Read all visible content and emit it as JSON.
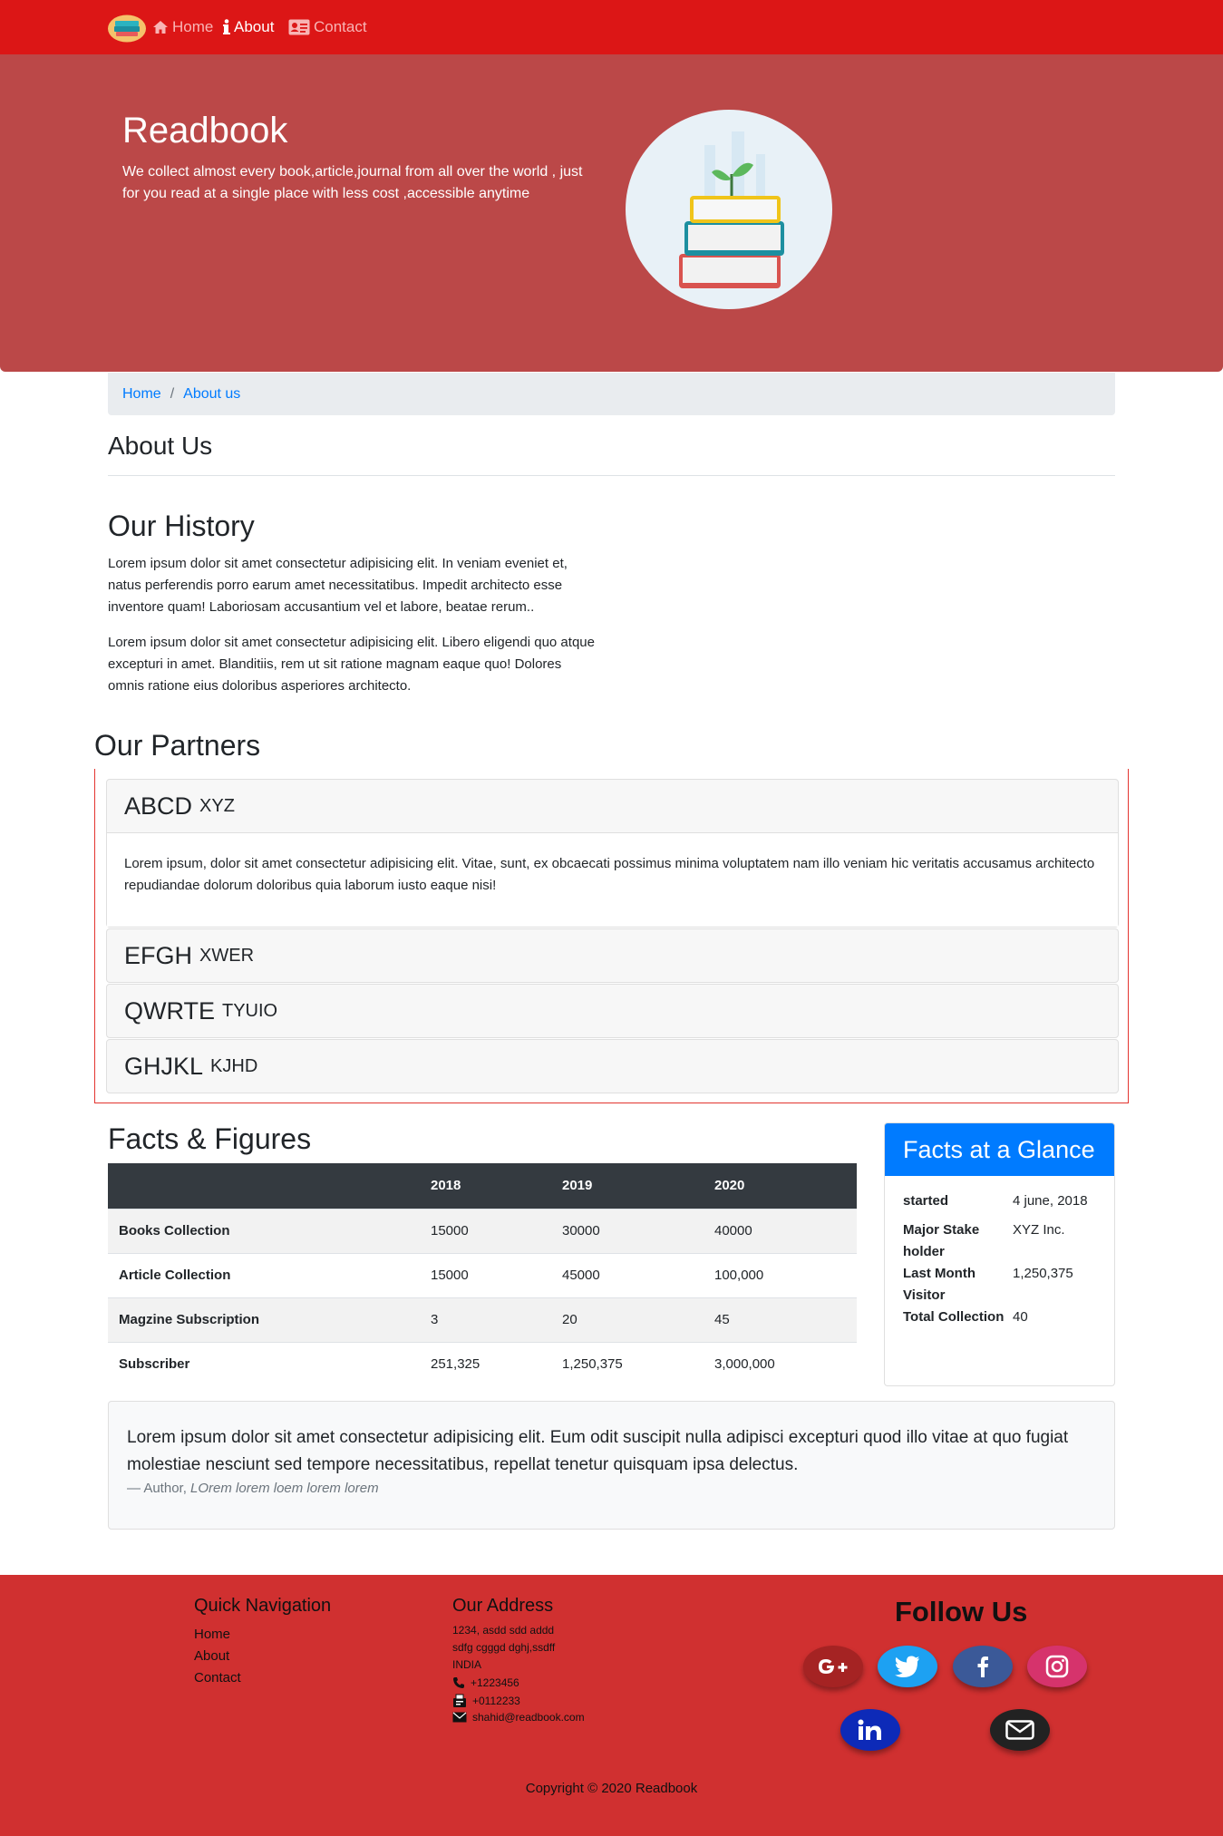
{
  "nav": {
    "brand_icon": "books-icon",
    "links": [
      {
        "label": "Home",
        "icon": "home-icon",
        "active": false
      },
      {
        "label": "About",
        "icon": "info-icon",
        "active": true
      },
      {
        "label": "Contact",
        "icon": "contact-card-icon",
        "active": false
      }
    ]
  },
  "hero": {
    "title": "Readbook",
    "text": "We collect almost every book,article,journal from all over the world , just for you read at a single place with less cost ,accessible anytime"
  },
  "breadcrumb": {
    "home": "Home",
    "current": "About us",
    "separator": "/"
  },
  "about": {
    "title": "About Us"
  },
  "history": {
    "title": "Our History",
    "p1": "Lorem ipsum dolor sit amet consectetur adipisicing elit. In veniam eveniet et, natus perferendis porro earum amet necessitatibus. Impedit architecto esse inventore quam! Laboriosam accusantium vel et labore, beatae rerum..",
    "p2": "Lorem ipsum dolor sit amet consectetur adipisicing elit. Libero eligendi quo atque excepturi in amet. Blanditiis, rem ut sit ratione magnam eaque quo! Dolores omnis ratione eius doloribus asperiores architecto."
  },
  "partners": {
    "title": "Our Partners",
    "items": [
      {
        "name": "ABCD",
        "sub": "xyz",
        "body": "Lorem ipsum, dolor sit amet consectetur adipisicing elit. Vitae, sunt, ex obcaecati possimus minima voluptatem nam illo veniam hic veritatis accusamus architecto repudiandae dolorum doloribus quia laborum iusto eaque nisi!"
      },
      {
        "name": "EFGH",
        "sub": "xwer"
      },
      {
        "name": "QWRTE",
        "sub": "tyuio"
      },
      {
        "name": "GHJKL",
        "sub": "kjhd"
      }
    ]
  },
  "facts": {
    "title": "Facts & Figures",
    "columns": [
      "",
      "2018",
      "2019",
      "2020"
    ],
    "rows": [
      [
        "Books Collection",
        "15000",
        "30000",
        "40000"
      ],
      [
        "Article Collection",
        "15000",
        "45000",
        "100,000"
      ],
      [
        "Magzine Subscription",
        "3",
        "20",
        "45"
      ],
      [
        "Subscriber",
        "251,325",
        "1,250,375",
        "3,000,000"
      ]
    ]
  },
  "glance": {
    "title": "Facts at a Glance",
    "items": [
      {
        "key": "started",
        "value": "4 june, 2018"
      },
      {
        "key": "Major Stake holder",
        "value": "XYZ Inc."
      },
      {
        "key": "Last Month Visitor",
        "value": "1,250,375"
      },
      {
        "key": "Total Collection",
        "value": "40"
      }
    ]
  },
  "quote": {
    "text": "Lorem ipsum dolor sit amet consectetur adipisicing elit. Eum odit suscipit nulla adipisci excepturi quod illo vitae at quo fugiat molestiae nesciunt sed tempore necessitatibus, repellat tenetur quisquam ipsa delectus.",
    "author_prefix": "— Author,",
    "source": "LOrem lorem loem lorem lorem"
  },
  "footer": {
    "nav_title": "Quick Navigation",
    "nav_links": [
      "Home",
      "About",
      "Contact"
    ],
    "address_title": "Our Address",
    "address_lines": [
      "1234, asdd sdd addd",
      "sdfg cgggd dghj,ssdff",
      "INDIA"
    ],
    "phone": "+1223456",
    "fax": "+0112233",
    "email": "shahid@readbook.com",
    "follow_title": "Follow Us",
    "social": [
      {
        "name": "google-plus-icon",
        "color": "#a52323"
      },
      {
        "name": "twitter-icon",
        "color": "#1da1f2"
      },
      {
        "name": "facebook-icon",
        "color": "#3b5998"
      },
      {
        "name": "instagram-icon",
        "color": "#d6336c"
      },
      {
        "name": "linkedin-icon",
        "color": "#0d2ab8"
      },
      {
        "name": "mail-icon",
        "color": "#222222"
      }
    ],
    "copyright": "Copyright © 2020 Readbook"
  },
  "colors": {
    "navbar": "#dc1616",
    "hero": "#bb4848",
    "footer": "#d03030",
    "link": "#007bff",
    "glance_header": "#007bff"
  }
}
